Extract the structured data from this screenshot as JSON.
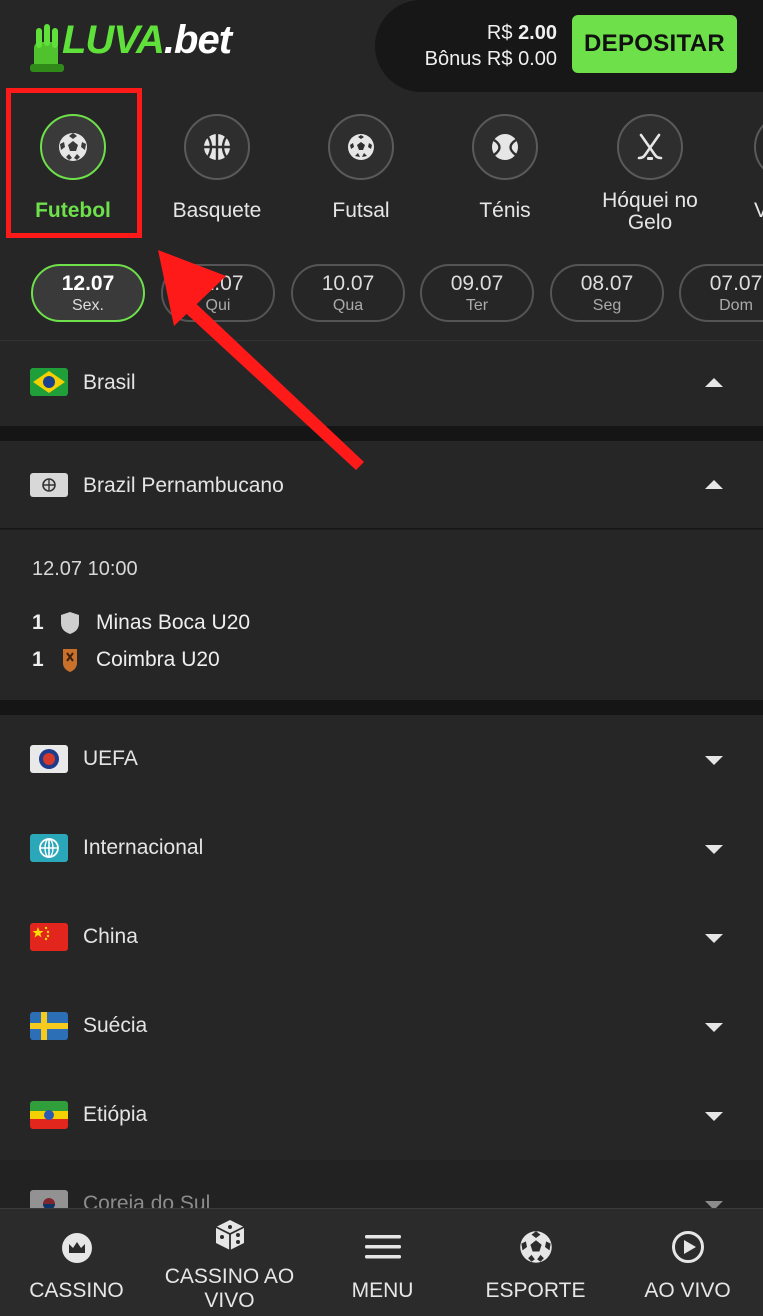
{
  "header": {
    "logo_luva": "LUVA",
    "logo_bet": ".bet",
    "balance_currency": "R$",
    "balance_value": "2.00",
    "bonus_label": "Bônus",
    "bonus_currency": "R$",
    "bonus_value": "0.00",
    "deposit_label": "DEPOSITAR"
  },
  "sports": [
    {
      "label": "Futebol",
      "active": true
    },
    {
      "label": "Basquete"
    },
    {
      "label": "Futsal"
    },
    {
      "label": "Ténis"
    },
    {
      "label": "Hóquei no Gelo"
    },
    {
      "label": "V"
    }
  ],
  "dates": [
    {
      "day": "12.07",
      "weekday": "Sex.",
      "active": true
    },
    {
      "day": "11.07",
      "weekday": "Qui"
    },
    {
      "day": "10.07",
      "weekday": "Qua"
    },
    {
      "day": "09.07",
      "weekday": "Ter"
    },
    {
      "day": "08.07",
      "weekday": "Seg"
    },
    {
      "day": "07.07",
      "weekday": "Dom"
    }
  ],
  "leagues": {
    "brasil": "Brasil",
    "pernambucano": "Brazil Pernambucano",
    "uefa": "UEFA",
    "internacional": "Internacional",
    "china": "China",
    "suecia": "Suécia",
    "etiopia": "Etiópia",
    "coreia": "Coreia do Sul"
  },
  "match": {
    "time": "12.07 10:00",
    "home_score": "1",
    "home_team": "Minas Boca U20",
    "away_score": "1",
    "away_team": "Coimbra U20"
  },
  "bottom_nav": [
    {
      "label": "CASSINO",
      "icon": "crown-icon"
    },
    {
      "label": "CASSINO AO VIVO",
      "icon": "dice-icon"
    },
    {
      "label": "MENU",
      "icon": "hamburger-icon"
    },
    {
      "label": "ESPORTE",
      "icon": "soccer-ball-icon"
    },
    {
      "label": "AO VIVO",
      "icon": "play-circle-icon"
    }
  ],
  "colors": {
    "accent": "#6de04a",
    "background": "#262626",
    "annotation": "#ff1a1a"
  }
}
